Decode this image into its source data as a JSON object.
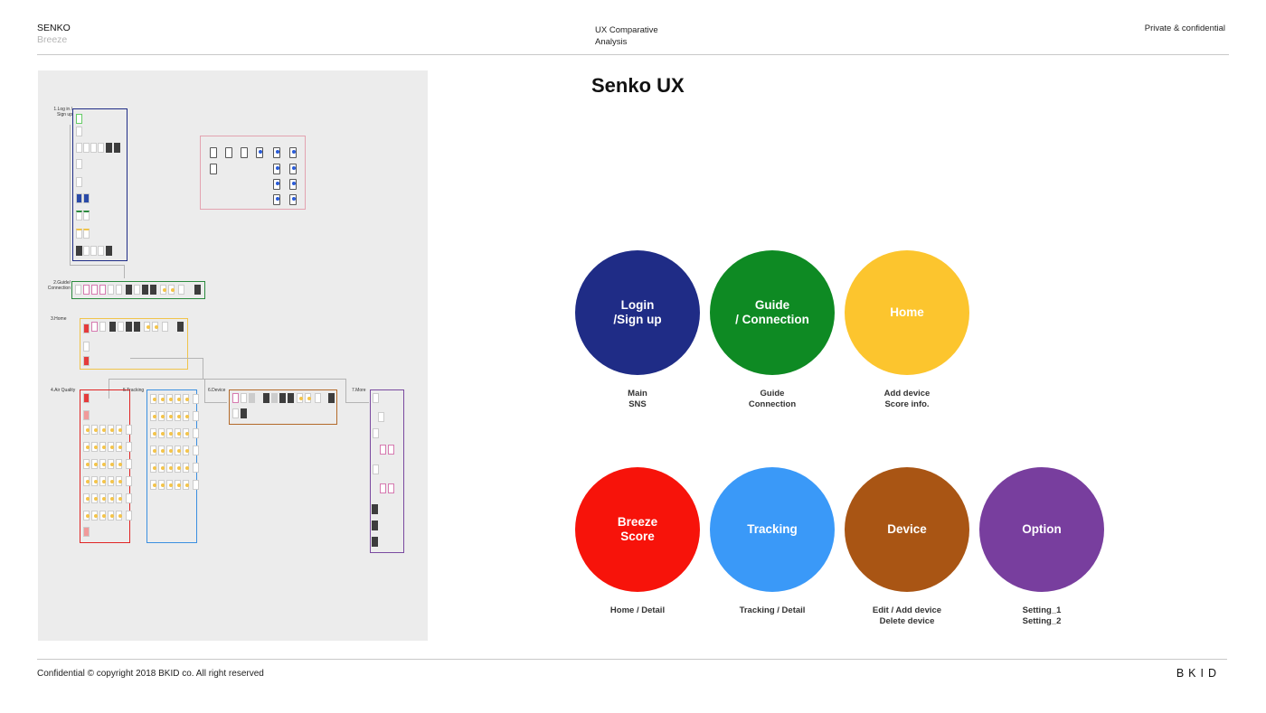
{
  "header": {
    "brand": "SENKO",
    "brand_sub": "Breeze",
    "doc_title_line1": "UX Comparative",
    "doc_title_line2": "Analysis",
    "confidentiality": "Private & confidential"
  },
  "footer": {
    "copyright": "Confidential  © copyright 2018 BKID co. All right reserved",
    "logo": "BKID"
  },
  "flow_diagram": {
    "sections": [
      {
        "id": "login",
        "label": "1.Log in / Sign up",
        "color": "#1f2c86"
      },
      {
        "id": "guide",
        "label": "2.Guide/ Connection",
        "color": "#2b8a3e"
      },
      {
        "id": "home",
        "label": "3.Home",
        "color": "#f0c44b"
      },
      {
        "id": "air",
        "label": "4.Air Quality",
        "color": "#e02424"
      },
      {
        "id": "tracking",
        "label": "5.Tracking",
        "color": "#3b8fe0"
      },
      {
        "id": "device",
        "label": "6.Device",
        "color": "#b36a2a"
      },
      {
        "id": "more",
        "label": "7.More",
        "color": "#7a4aa0"
      },
      {
        "id": "extra",
        "label": "",
        "color": "#e3a3b0"
      }
    ]
  },
  "main": {
    "title": "Senko UX",
    "modules": [
      {
        "name": "Login\n/Sign up",
        "color": "#1f2c86",
        "caption": "Main\nSNS"
      },
      {
        "name": "Guide\n/ Connection",
        "color": "#0e8a23",
        "caption": "Guide\nConnection"
      },
      {
        "name": "Home",
        "color": "#fcc52e",
        "caption": "Add device\nScore info."
      },
      {
        "name": "Breeze\nScore",
        "color": "#f7130a",
        "caption": "Home / Detail"
      },
      {
        "name": "Tracking",
        "color": "#3a99f8",
        "caption": "Tracking / Detail"
      },
      {
        "name": "Device",
        "color": "#a95514",
        "caption": "Edit / Add device\nDelete device"
      },
      {
        "name": "Option",
        "color": "#783e9e",
        "caption": "Setting_1\nSetting_2"
      }
    ]
  }
}
